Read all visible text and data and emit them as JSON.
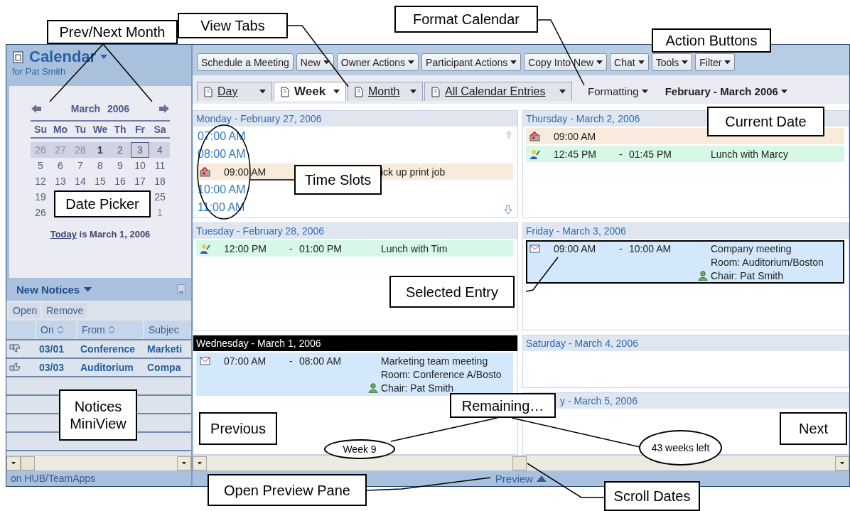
{
  "calendar_header": {
    "title": "Calendar",
    "owner": "for Pat Smith"
  },
  "date_picker": {
    "month": "March",
    "year": "2006",
    "weekdays": [
      "Su",
      "Mo",
      "Tu",
      "We",
      "Th",
      "Fr",
      "Sa"
    ],
    "weeks": [
      {
        "current": true,
        "days": [
          {
            "day": "26",
            "other_month": true,
            "today": false,
            "selected": false
          },
          {
            "day": "27",
            "other_month": true,
            "today": false,
            "selected": false
          },
          {
            "day": "28",
            "other_month": true,
            "today": false,
            "selected": false
          },
          {
            "day": "1",
            "other_month": false,
            "today": true,
            "selected": false
          },
          {
            "day": "2",
            "other_month": false,
            "today": false,
            "selected": false
          },
          {
            "day": "3",
            "other_month": false,
            "today": false,
            "selected": true
          },
          {
            "day": "4",
            "other_month": false,
            "today": false,
            "selected": false
          }
        ]
      },
      {
        "current": false,
        "days": [
          {
            "day": "5",
            "other_month": false,
            "today": false,
            "selected": false
          },
          {
            "day": "6",
            "other_month": false,
            "today": false,
            "selected": false
          },
          {
            "day": "7",
            "other_month": false,
            "today": false,
            "selected": false
          },
          {
            "day": "8",
            "other_month": false,
            "today": false,
            "selected": false
          },
          {
            "day": "9",
            "other_month": false,
            "today": false,
            "selected": false
          },
          {
            "day": "10",
            "other_month": false,
            "today": false,
            "selected": false
          },
          {
            "day": "11",
            "other_month": false,
            "today": false,
            "selected": false
          }
        ]
      },
      {
        "current": false,
        "days": [
          {
            "day": "12",
            "other_month": false,
            "today": false,
            "selected": false
          },
          {
            "day": "13",
            "other_month": false,
            "today": false,
            "selected": false
          },
          {
            "day": "14",
            "other_month": false,
            "today": false,
            "selected": false
          },
          {
            "day": "15",
            "other_month": false,
            "today": false,
            "selected": false
          },
          {
            "day": "16",
            "other_month": false,
            "today": false,
            "selected": false
          },
          {
            "day": "17",
            "other_month": false,
            "today": false,
            "selected": false
          },
          {
            "day": "18",
            "other_month": false,
            "today": false,
            "selected": false
          }
        ]
      },
      {
        "current": false,
        "days": [
          {
            "day": "19",
            "other_month": false,
            "today": false,
            "selected": false
          }
        ],
        "trailing_days": [
          {
            "day": "25",
            "other_month": false,
            "today": false,
            "selected": false
          }
        ]
      },
      {
        "current": false,
        "days": [
          {
            "day": "26",
            "other_month": false,
            "today": false,
            "selected": false
          }
        ],
        "trailing_days": [
          {
            "day": "1",
            "other_month": true,
            "today": false,
            "selected": false
          }
        ]
      }
    ],
    "today_link": "Today",
    "today_text": "is March 1, 2006"
  },
  "notices": {
    "title": "New Notices",
    "actions": [
      "Open",
      "Remove"
    ],
    "columns": [
      {
        "label": "On",
        "sortable": true
      },
      {
        "label": "From",
        "sortable": true
      },
      {
        "label": "Subjec",
        "sortable": false
      }
    ],
    "rows": [
      {
        "kind": "declined",
        "on": "03/01",
        "from": "Conference",
        "subject": "Marketi"
      },
      {
        "kind": "accepted",
        "on": "03/03",
        "from": "Auditorium",
        "subject": "Compa"
      }
    ]
  },
  "status": "on HUB/TeamApps",
  "toolbar": [
    {
      "label": "Schedule a Meeting",
      "menu": false
    },
    {
      "label": "New",
      "menu": true
    },
    {
      "label": "Owner Actions",
      "menu": true
    },
    {
      "label": "Participant Actions",
      "menu": true
    },
    {
      "label": "Copy Into New",
      "menu": true
    },
    {
      "label": "Chat",
      "menu": true
    },
    {
      "label": "Tools",
      "menu": true
    },
    {
      "label": "Filter",
      "menu": true
    }
  ],
  "view_tabs": [
    {
      "label": "Day",
      "selected": false
    },
    {
      "label": "Week",
      "selected": true
    },
    {
      "label": "Month",
      "selected": false
    },
    {
      "label": "All Calendar Entries",
      "selected": false
    }
  ],
  "formatting": "Formatting",
  "date_range": "February - March 2006",
  "week": {
    "left": [
      {
        "title": "Monday - February 27, 2006",
        "current": false,
        "items": [
          {
            "kind": "slot",
            "time": "07:00 AM"
          },
          {
            "kind": "slot",
            "time": "08:00 AM"
          },
          {
            "kind": "reminder",
            "start": "09:00 AM",
            "title": "ick up print job",
            "selected": false
          },
          {
            "kind": "slot",
            "time": "10:00 AM"
          },
          {
            "kind": "slot",
            "time": "11:00 AM"
          }
        ]
      },
      {
        "title": "Tuesday - February 28, 2006",
        "current": false,
        "items": [
          {
            "kind": "appointment",
            "start": "12:00 PM",
            "separator": "-",
            "end": "01:00 PM",
            "title": "Lunch with Tim",
            "selected": false
          }
        ]
      },
      {
        "title": "Wednesday - March 1, 2006",
        "current": true,
        "items": [
          {
            "kind": "meeting",
            "start": "07:00 AM",
            "separator": "-",
            "end": "08:00 AM",
            "title": "Marketing team meeting",
            "room": "Room: Conference A/Bosto",
            "chair": "Chair: Pat Smith",
            "selected": false
          }
        ]
      }
    ],
    "right": [
      {
        "title": "Thursday - March 2, 2006",
        "current": false,
        "items": [
          {
            "kind": "reminder",
            "start": "09:00 AM",
            "selected": false
          },
          {
            "kind": "appointment",
            "start": "12:45 PM",
            "separator": "-",
            "end": "01:45 PM",
            "title": "Lunch with Marcy",
            "selected": false
          }
        ]
      },
      {
        "title": "Friday - March 3, 2006",
        "current": false,
        "items": [
          {
            "kind": "meeting",
            "start": "09:00 AM",
            "separator": "-",
            "end": "10:00 AM",
            "title": "Company meeting",
            "room": "Room: Auditorium/Boston",
            "chair": "Chair: Pat Smith",
            "selected": true
          }
        ]
      },
      {
        "title": "Saturday - March 4, 2006",
        "current": false
      },
      {
        "title": "y - March 5, 2006",
        "current": false
      }
    ]
  },
  "preview": "Preview",
  "callouts": [
    {
      "text": "Prev/Next Month",
      "kind": "box"
    },
    {
      "text": "View Tabs",
      "kind": "box"
    },
    {
      "text": "Format Calendar",
      "kind": "box"
    },
    {
      "text": "Action Buttons",
      "kind": "box"
    },
    {
      "text": "Current Date",
      "kind": "box"
    },
    {
      "text": "Time Slots",
      "kind": "box"
    },
    {
      "text": "Date Picker",
      "kind": "box"
    },
    {
      "text": "Selected Entry",
      "kind": "box"
    },
    {
      "text": "Notices MiniView",
      "kind": "box"
    },
    {
      "text": "Previous",
      "kind": "box"
    },
    {
      "text": "Remaining…",
      "kind": "box"
    },
    {
      "text": "Next",
      "kind": "box"
    },
    {
      "text": "Week 9",
      "kind": "ellipse"
    },
    {
      "text": "43 weeks left",
      "kind": "ellipse"
    },
    {
      "text": "Open Preview Pane",
      "kind": "box"
    },
    {
      "text": "Scroll Dates",
      "kind": "box"
    }
  ]
}
